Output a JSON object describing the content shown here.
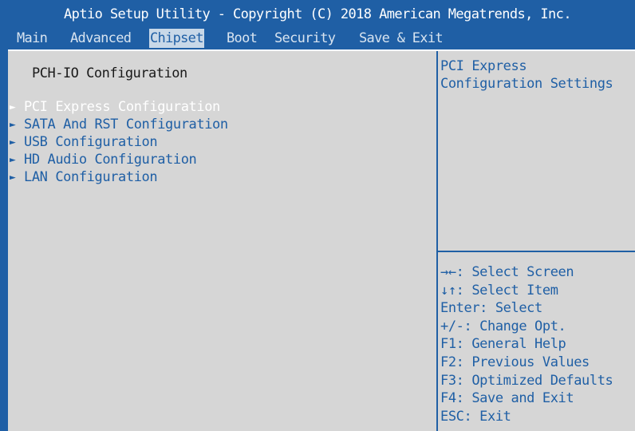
{
  "title": "Aptio Setup Utility - Copyright (C) 2018 American Megatrends, Inc.",
  "tabs": [
    {
      "label": "Main"
    },
    {
      "label": "Advanced"
    },
    {
      "label": "Chipset",
      "active": true
    },
    {
      "label": "Boot"
    },
    {
      "label": "Security"
    },
    {
      "label": "Save & Exit"
    }
  ],
  "section_title": "PCH-IO Configuration",
  "items": [
    {
      "label": "PCI Express Configuration",
      "selected": true
    },
    {
      "label": "SATA And RST Configuration"
    },
    {
      "label": "USB Configuration"
    },
    {
      "label": "HD Audio Configuration"
    },
    {
      "label": "LAN Configuration"
    }
  ],
  "submenu_arrow": "►",
  "help": {
    "title_line1": "PCI Express",
    "title_line2": "Configuration Settings"
  },
  "keys": [
    "→←: Select Screen",
    "↓↑: Select Item",
    "Enter: Select",
    "+/-: Change Opt.",
    "F1: General Help",
    "F2: Previous Values",
    "F3: Optimized Defaults",
    "F4: Save and Exit",
    "ESC: Exit"
  ],
  "colors": {
    "background": "#1f5fa5",
    "panel": "#d6d6d6",
    "highlight_text": "#ffffff",
    "active_tab_bg": "#c8d8e8"
  }
}
